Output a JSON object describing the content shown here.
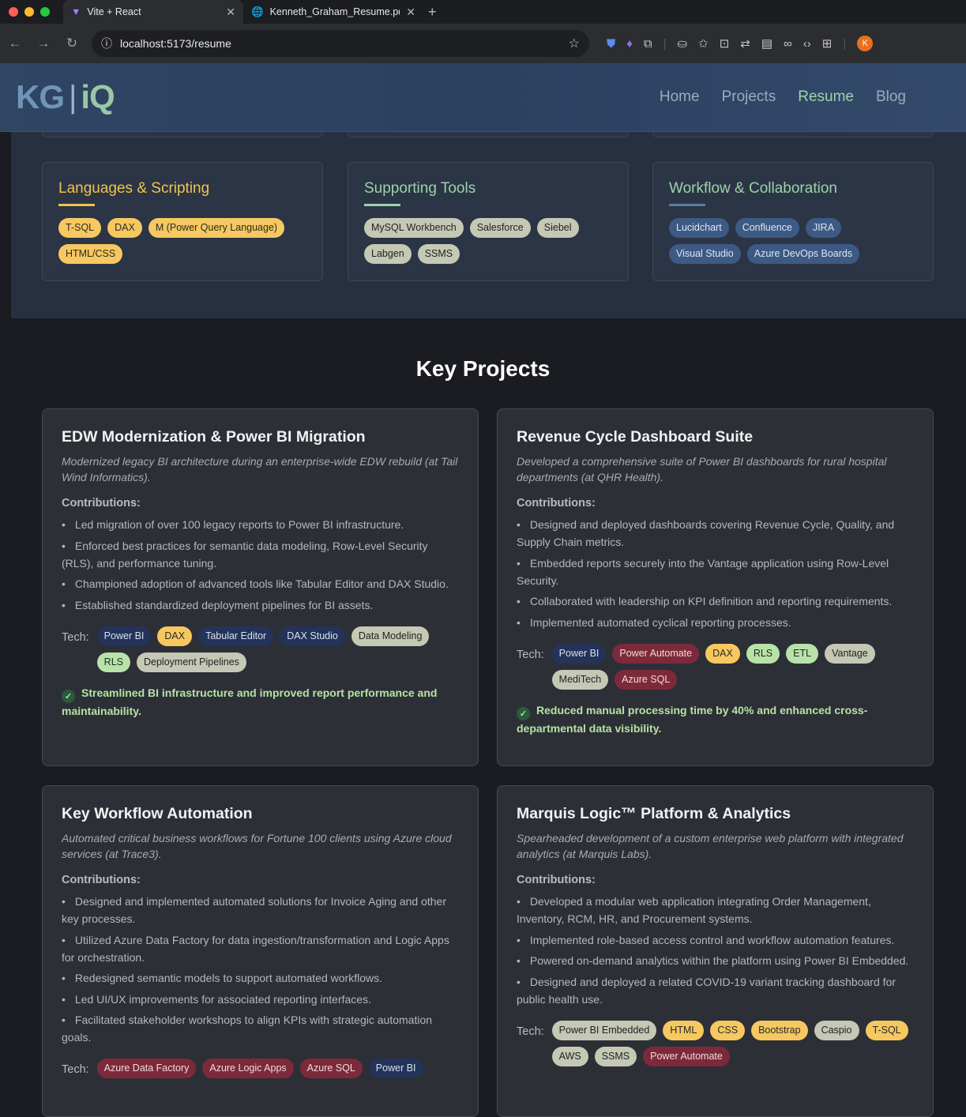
{
  "browser": {
    "tabs": [
      {
        "label": "Vite + React",
        "active": true
      },
      {
        "label": "Kenneth_Graham_Resume.pd",
        "active": false
      }
    ],
    "url": "localhost:5173/resume",
    "avatar_initial": "K"
  },
  "header": {
    "logo_kg": "KG",
    "logo_sep": "|",
    "logo_iq": "iQ",
    "nav": [
      {
        "label": "Home",
        "active": false
      },
      {
        "label": "Projects",
        "active": false
      },
      {
        "label": "Resume",
        "active": true
      },
      {
        "label": "Blog",
        "active": false
      }
    ]
  },
  "skills": [
    {
      "title": "Languages & Scripting",
      "items": [
        {
          "label": "T-SQL",
          "color": "yellow"
        },
        {
          "label": "DAX",
          "color": "yellow"
        },
        {
          "label": "M (Power Query Language)",
          "color": "yellow"
        },
        {
          "label": "HTML/CSS",
          "color": "yellow"
        }
      ]
    },
    {
      "title": "Supporting Tools",
      "items": [
        {
          "label": "MySQL Workbench",
          "color": "gray"
        },
        {
          "label": "Salesforce",
          "color": "gray"
        },
        {
          "label": "Siebel",
          "color": "gray"
        },
        {
          "label": "Labgen",
          "color": "gray"
        },
        {
          "label": "SSMS",
          "color": "gray"
        }
      ]
    },
    {
      "title": "Workflow & Collaboration",
      "items": [
        {
          "label": "Lucidchart",
          "color": "blue"
        },
        {
          "label": "Confluence",
          "color": "blue"
        },
        {
          "label": "JIRA",
          "color": "blue"
        },
        {
          "label": "Visual Studio",
          "color": "blue"
        },
        {
          "label": "Azure DevOps Boards",
          "color": "blue"
        }
      ]
    }
  ],
  "key_projects_title": "Key Projects",
  "contributions_label": "Contributions:",
  "tech_label": "Tech:",
  "projects": [
    {
      "title": "EDW Modernization & Power BI Migration",
      "description": "Modernized legacy BI architecture during an enterprise-wide EDW rebuild (at Tail Wind Informatics).",
      "contributions": [
        "Led migration of over 100 legacy reports to Power BI infrastructure.",
        "Enforced best practices for semantic data modeling, Row-Level Security (RLS), and performance tuning.",
        "Championed adoption of advanced tools like Tabular Editor and DAX Studio.",
        "Established standardized deployment pipelines for BI assets."
      ],
      "tech": [
        {
          "label": "Power BI",
          "color": "navy"
        },
        {
          "label": "DAX",
          "color": "yellow"
        },
        {
          "label": "Tabular Editor",
          "color": "navy"
        },
        {
          "label": "DAX Studio",
          "color": "navy"
        },
        {
          "label": "Data Modeling",
          "color": "gray"
        },
        {
          "label": "RLS",
          "color": "green"
        },
        {
          "label": "Deployment Pipelines",
          "color": "gray"
        }
      ],
      "outcome": "Streamlined BI infrastructure and improved report performance and maintainability."
    },
    {
      "title": "Revenue Cycle Dashboard Suite",
      "description": "Developed a comprehensive suite of Power BI dashboards for rural hospital departments (at QHR Health).",
      "contributions": [
        "Designed and deployed dashboards covering Revenue Cycle, Quality, and Supply Chain metrics.",
        "Embedded reports securely into the Vantage application using Row-Level Security.",
        "Collaborated with leadership on KPI definition and reporting requirements.",
        "Implemented automated cyclical reporting processes."
      ],
      "tech": [
        {
          "label": "Power BI",
          "color": "navy"
        },
        {
          "label": "Power Automate",
          "color": "red"
        },
        {
          "label": "DAX",
          "color": "yellow"
        },
        {
          "label": "RLS",
          "color": "green"
        },
        {
          "label": "ETL",
          "color": "green"
        },
        {
          "label": "Vantage",
          "color": "gray"
        },
        {
          "label": "MediTech",
          "color": "gray"
        },
        {
          "label": "Azure SQL",
          "color": "red"
        }
      ],
      "outcome": "Reduced manual processing time by 40% and enhanced cross-departmental data visibility."
    },
    {
      "title": "Key Workflow Automation",
      "description": "Automated critical business workflows for Fortune 100 clients using Azure cloud services (at Trace3).",
      "contributions": [
        "Designed and implemented automated solutions for Invoice Aging and other key processes.",
        "Utilized Azure Data Factory for data ingestion/transformation and Logic Apps for orchestration.",
        "Redesigned semantic models to support automated workflows.",
        "Led UI/UX improvements for associated reporting interfaces.",
        "Facilitated stakeholder workshops to align KPIs with strategic automation goals."
      ],
      "tech": [
        {
          "label": "Azure Data Factory",
          "color": "red"
        },
        {
          "label": "Azure Logic Apps",
          "color": "red"
        },
        {
          "label": "Azure SQL",
          "color": "red"
        },
        {
          "label": "Power BI",
          "color": "navy"
        }
      ],
      "outcome": ""
    },
    {
      "title": "Marquis Logic™ Platform & Analytics",
      "description": "Spearheaded development of a custom enterprise web platform with integrated analytics (at Marquis Labs).",
      "contributions": [
        "Developed a modular web application integrating Order Management, Inventory, RCM, HR, and Procurement systems.",
        "Implemented role-based access control and workflow automation features.",
        "Powered on-demand analytics within the platform using Power BI Embedded.",
        "Designed and deployed a related COVID-19 variant tracking dashboard for public health use."
      ],
      "tech": [
        {
          "label": "Power BI Embedded",
          "color": "gray"
        },
        {
          "label": "HTML",
          "color": "yellow"
        },
        {
          "label": "CSS",
          "color": "yellow"
        },
        {
          "label": "Bootstrap",
          "color": "yellow"
        },
        {
          "label": "Caspio",
          "color": "gray"
        },
        {
          "label": "T-SQL",
          "color": "yellow"
        },
        {
          "label": "AWS",
          "color": "gray"
        },
        {
          "label": "SSMS",
          "color": "gray"
        },
        {
          "label": "Power Automate",
          "color": "red"
        }
      ],
      "outcome": ""
    }
  ]
}
